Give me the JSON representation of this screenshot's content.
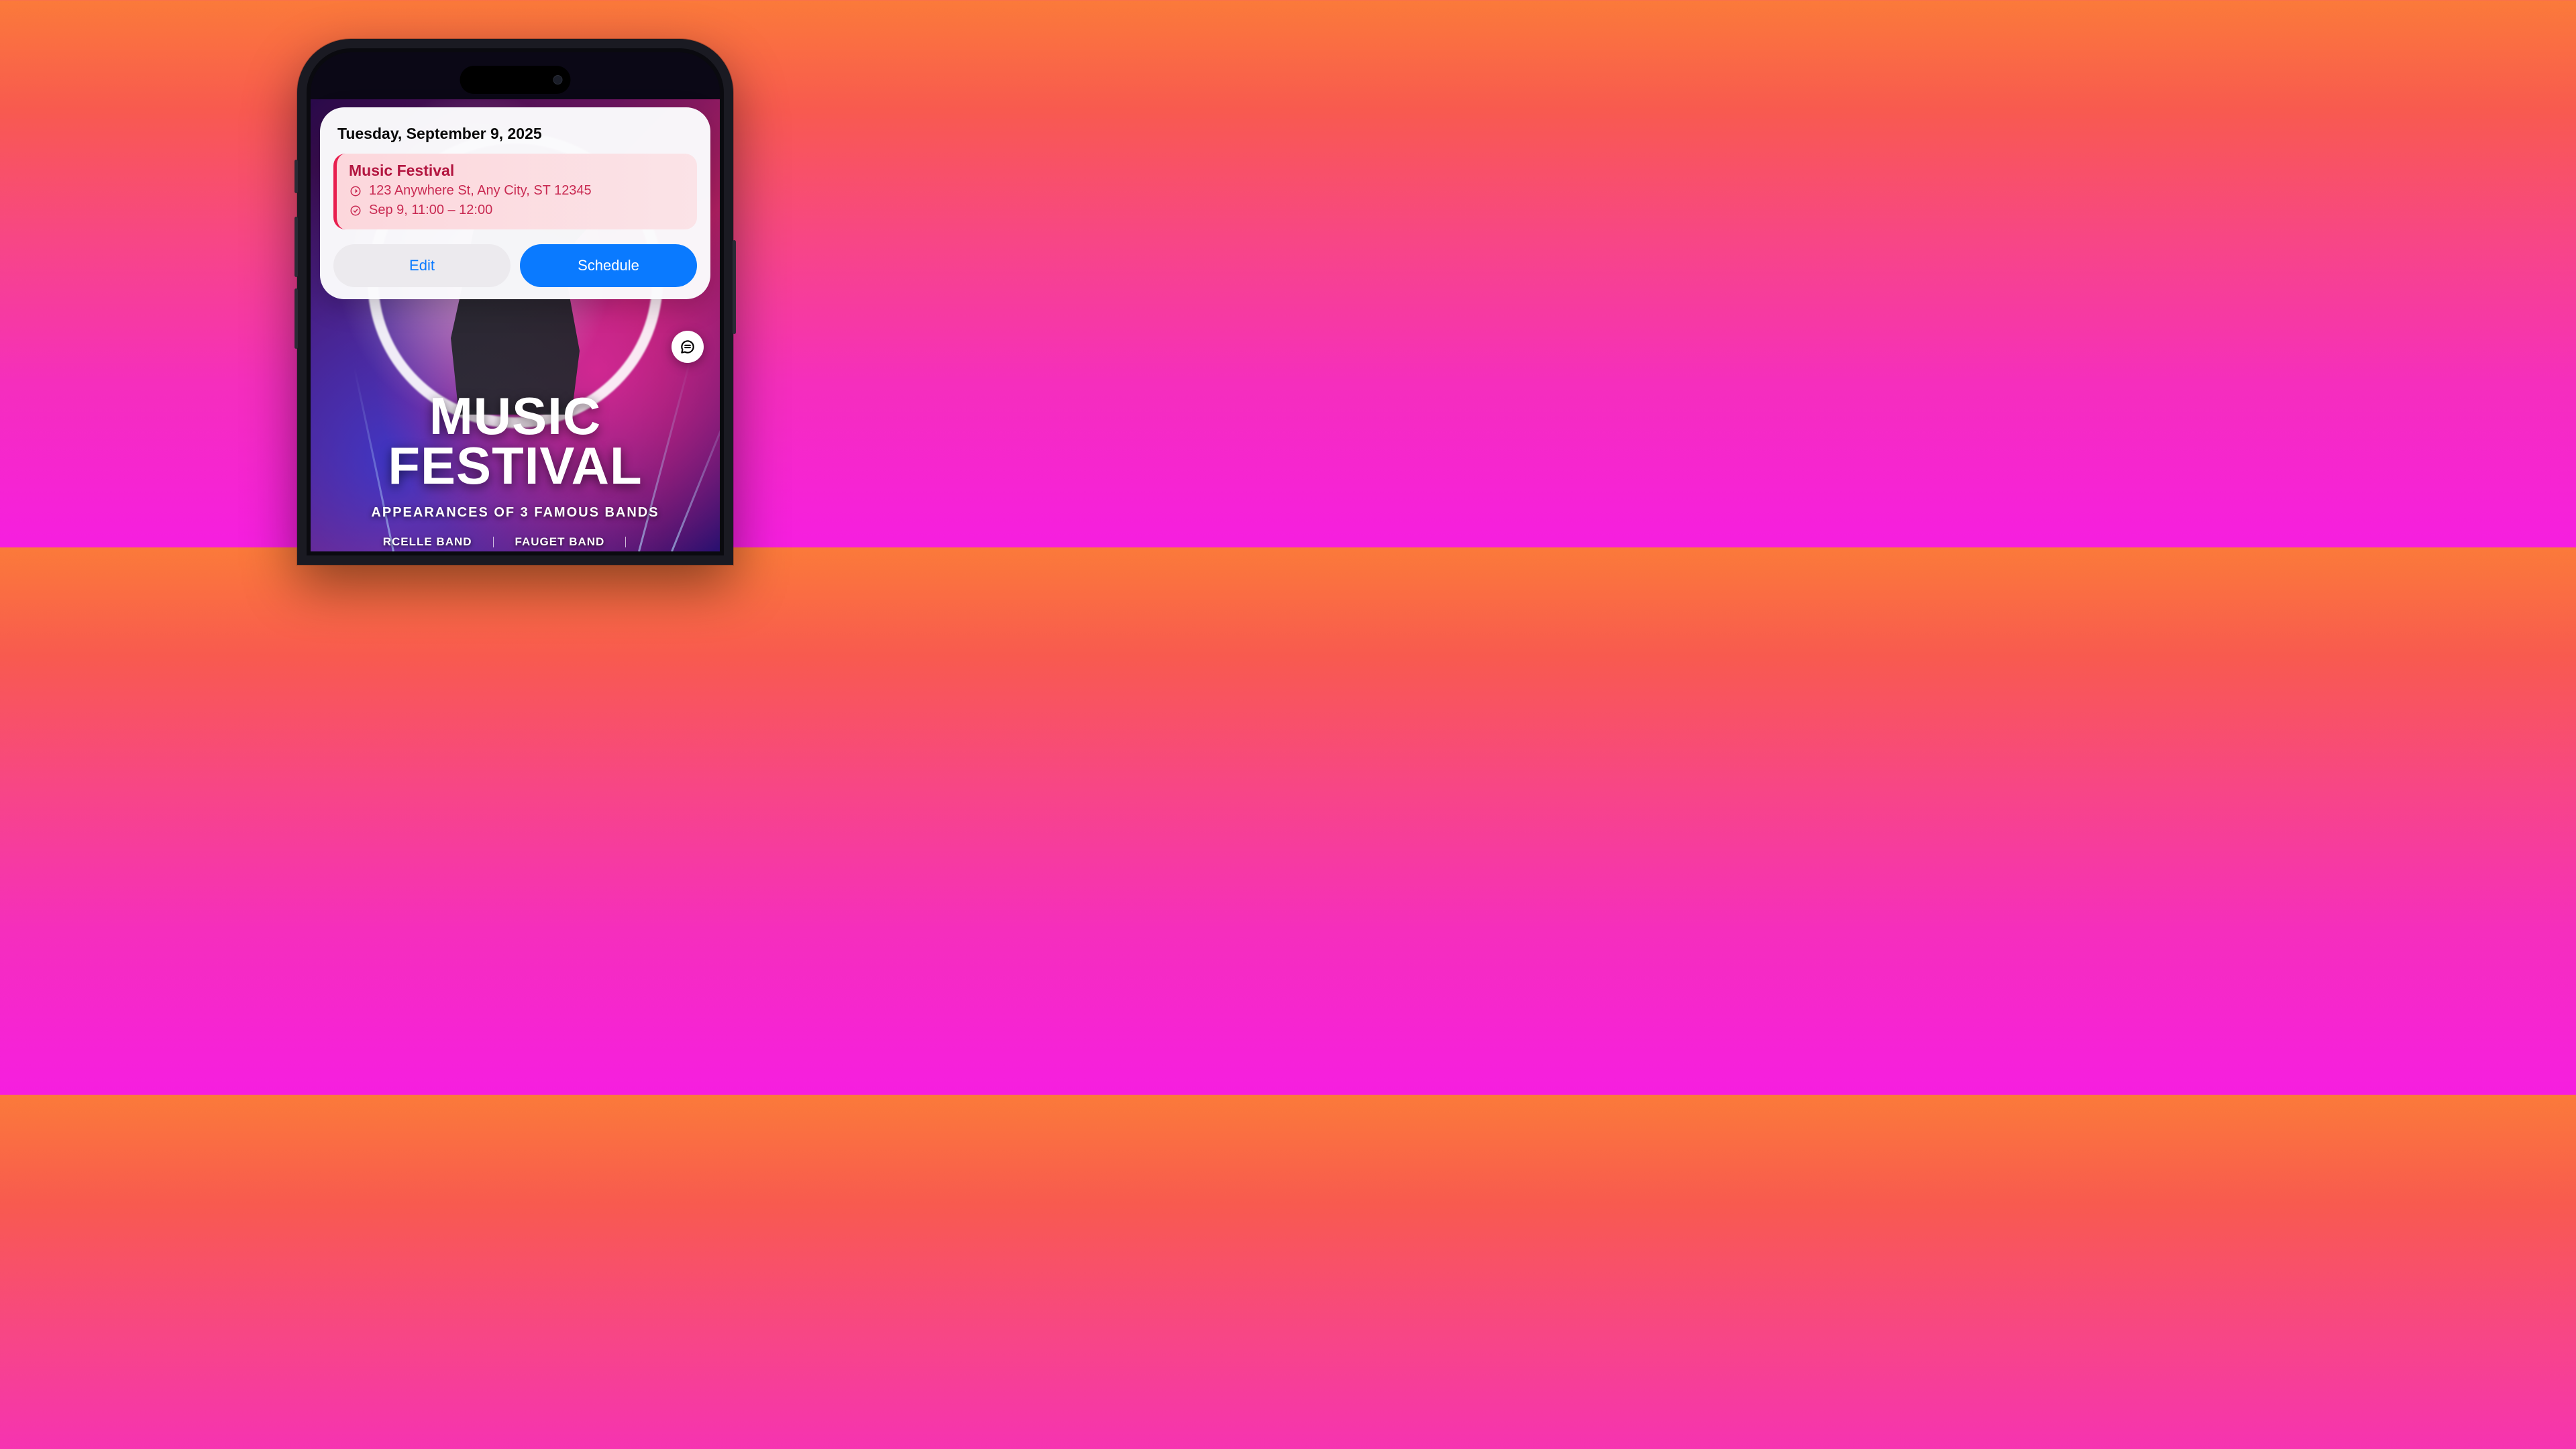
{
  "card": {
    "date_heading": "Tuesday, September 9, 2025",
    "event": {
      "title": "Music Festival",
      "location": "123 Anywhere St, Any City, ST 12345",
      "time": "Sep 9, 11:00 – 12:00"
    },
    "buttons": {
      "edit_label": "Edit",
      "schedule_label": "Schedule"
    }
  },
  "poster": {
    "title_line1": "MUSIC",
    "title_line2": "FESTIVAL",
    "subtitle": "APPEARANCES OF 3 FAMOUS BANDS",
    "bands": [
      "RCELLE BAND",
      "FAUGET BAND",
      ""
    ]
  },
  "colors": {
    "accent_red": "#e81f4f",
    "accent_blue": "#0a7aff",
    "event_bg": "#fcd7dc"
  }
}
